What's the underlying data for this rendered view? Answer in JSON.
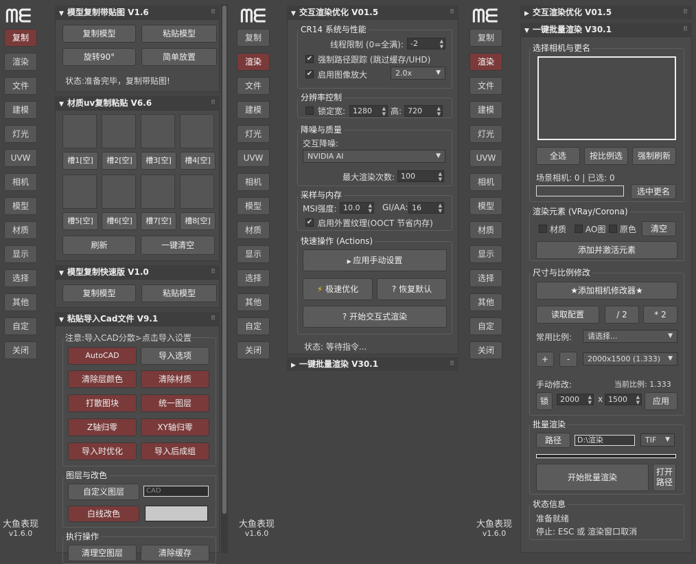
{
  "nav": [
    "复制",
    "渲染",
    "文件",
    "建模",
    "灯光",
    "UVW",
    "相机",
    "模型",
    "材质",
    "显示",
    "选择",
    "其他",
    "自定",
    "关闭"
  ],
  "brand": {
    "name": "大鱼表现",
    "version": "v1.6.0"
  },
  "col1": {
    "roll1": {
      "title": "模型复制带贴图  V1.6",
      "b1": "复制模型",
      "b2": "粘贴模型",
      "b3": "旋转90°",
      "b4": "简单放置",
      "status": "状态:准备完毕，复制带贴图!"
    },
    "roll2": {
      "title": "材质uv复制粘贴  V6.6",
      "slots": [
        "槽1[空]",
        "槽2[空]",
        "槽3[空]",
        "槽4[空]",
        "槽5[空]",
        "槽6[空]",
        "槽7[空]",
        "槽8[空]"
      ],
      "refresh": "刷新",
      "clear": "一键清空"
    },
    "roll3": {
      "title": "模型复制快速版  V1.0",
      "b1": "复制模型",
      "b2": "粘贴模型"
    },
    "roll4": {
      "title": "粘贴导入Cad文件 V9.1",
      "note": "注意:导入CAD分散>点击导入设置",
      "autocad": "AutoCAD",
      "import_opts": "导入选项",
      "clr_layer": "清除层颜色",
      "clr_mat": "清除材质",
      "explode": "打散图块",
      "unify": "统一图层",
      "z0": "Z轴归零",
      "xy0": "XY轴归零",
      "opt": "导入时优化",
      "group": "导入后成组",
      "grp_title": "图层与改色",
      "custom_layer": "自定义图层",
      "cad_ph": "CAD",
      "wire": "白线改色",
      "exec": "执行操作",
      "clean_layer": "清理空图层",
      "clean_cache": "清除缓存"
    }
  },
  "col2": {
    "roll1": {
      "title": "交互渲染优化 V01.5",
      "g1": {
        "title": "CR14 系统与性能",
        "threads_lbl": "线程限制 (0=全满):",
        "threads": "-2",
        "force": "强制路径跟踪 (跳过缓存/UHD)",
        "upscale": "启用图像放大",
        "upscale_val": "2.0x"
      },
      "g2": {
        "title": "分辨率控制",
        "lock": "锁定宽:",
        "w": "1280",
        "h_lbl": "高:",
        "h": "720"
      },
      "g3": {
        "title": "降噪与质量",
        "denoise_lbl": "交互降噪:",
        "denoise": "NVIDIA AI",
        "max_lbl": "最大渲染次数:",
        "max": "100"
      },
      "g4": {
        "title": "采样与内存",
        "msi_lbl": "MSI强度:",
        "msi": "10.0",
        "gi_lbl": "GI/AA:",
        "gi": "16",
        "ooct": "启用外置纹理(OOCT 节省内存)"
      },
      "g5": {
        "title": "快速操作 (Actions)",
        "apply": "应用手动设置",
        "fast": "极速优化",
        "restore": "恢复默认",
        "start": "开始交互式渲染"
      },
      "status": "状态: 等待指令..."
    },
    "roll2": {
      "title": "一键批量渲染 V30.1"
    }
  },
  "col3": {
    "roll1": {
      "title": "交互渲染优化 V01.5"
    },
    "roll2": {
      "title": "一键批量渲染 V30.1",
      "cam_grp": "选择相机与更名",
      "all": "全选",
      "by_ratio": "按比例选",
      "refresh": "强制刷新",
      "count": "场景相机: 0 | 已选: 0",
      "rename": "选中更名",
      "elem_grp": "渲染元素 (VRay/Corona)",
      "mat": "材质",
      "ao": "AO图",
      "orig": "原色",
      "clear": "清空",
      "add_elem": "添加并激活元素",
      "size_grp": "尺寸与比例修改",
      "add_mod": "★添加相机修改器★",
      "read": "读取配置",
      "div2": "/ 2",
      "mul2": "* 2",
      "common": "常用比例:",
      "pick": "请选择...",
      "plus": "+",
      "minus": "-",
      "preset": "2000x1500 (1.333)",
      "manual": "手动修改:",
      "cur": "当前比例: 1.333",
      "lock": "锁",
      "w": "2000",
      "x": "x",
      "h": "1500",
      "apply": "应用",
      "batch_grp": "批量渲染",
      "path": "路径",
      "path_val": "D:\\渲染",
      "fmt": "TIF",
      "start": "开始批量渲染",
      "open": "打开路径",
      "status_grp": "状态信息",
      "s1": "准备就绪",
      "s2": "停止: ESC 或 渲染窗口取消"
    }
  }
}
